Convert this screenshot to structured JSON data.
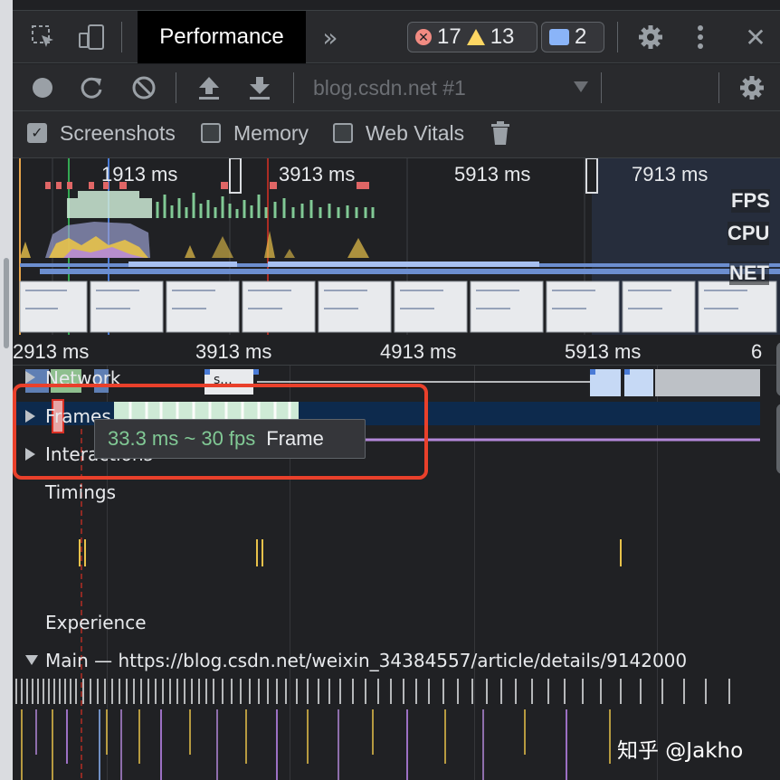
{
  "tabbar": {
    "inspect_icon": "inspect-element-icon",
    "device_icon": "device-toolbar-icon",
    "active_tab": "Performance",
    "more_tabs": "»",
    "errors": "17",
    "warnings": "13",
    "messages": "2",
    "settings_icon": "gear-icon",
    "menu_icon": "kebab-menu-icon",
    "close": "✕"
  },
  "toolbar": {
    "record_icon": "record-icon",
    "reload_icon": "reload-icon",
    "clear_icon": "clear-icon",
    "upload_icon": "upload-icon",
    "download_icon": "download-icon",
    "profile_select": "blog.csdn.net #1",
    "settings_icon": "gear-icon"
  },
  "checkboxes": {
    "screenshots": {
      "label": "Screenshots",
      "checked": true
    },
    "memory": {
      "label": "Memory",
      "checked": false
    },
    "web_vitals": {
      "label": "Web Vitals",
      "checked": false
    },
    "trash_icon": "trash-icon"
  },
  "overview": {
    "time_labels": [
      "1913 ms",
      "3913 ms",
      "5913 ms",
      "7913 ms"
    ],
    "fps_label": "FPS",
    "cpu_label": "CPU",
    "net_label": "NET"
  },
  "ruler": {
    "labels": [
      "2913 ms",
      "3913 ms",
      "4913 ms",
      "5913 ms",
      "6"
    ]
  },
  "tracks": {
    "network": "Network",
    "network_chip": "s...",
    "frames": "Frames",
    "interactions": "Interactions",
    "timings": "Timings",
    "experience": "Experience",
    "main": "Main — https://blog.csdn.net/weixin_34384557/article/details/9142000"
  },
  "tooltip": {
    "fps": "33.3 ms ~ 30 fps",
    "label": "Frame"
  },
  "colors": {
    "highlight": "#e9402b",
    "fps_green": "#81c995",
    "accent_blue": "#8ab4f8"
  },
  "watermark": "知乎 @Jakho"
}
